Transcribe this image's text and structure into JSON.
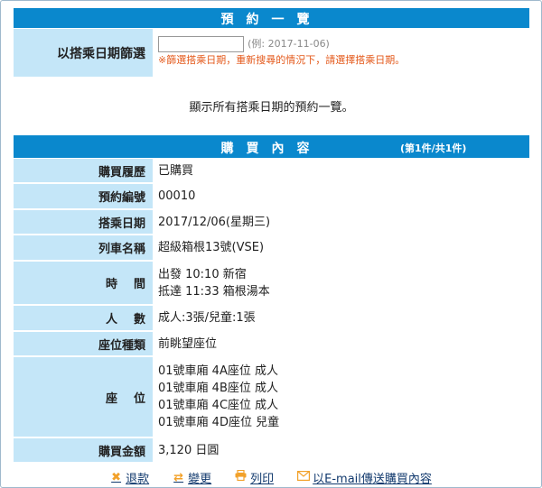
{
  "search": {
    "title": "預約一覽",
    "date_label": "以搭乘日期篩選",
    "date_value": "",
    "example": "(例: 2017-11-06)",
    "notice": "※篩選搭乘日期，重新搜尋的情況下，請選擇搭乘日期。",
    "all_message": "顯示所有搭乘日期的預約一覽。"
  },
  "detail": {
    "title": "購買內容",
    "count": "(第1件/共1件)",
    "rows": [
      {
        "label": "購買履歷",
        "lines": [
          "已購買"
        ]
      },
      {
        "label": "預約編號",
        "lines": [
          "00010"
        ]
      },
      {
        "label": "搭乘日期",
        "lines": [
          "2017/12/06(星期三)"
        ]
      },
      {
        "label": "列車名稱",
        "lines": [
          "超級箱根13號(VSE)"
        ]
      },
      {
        "label": "時間",
        "lines": [
          "出發 10:10 新宿",
          "抵達 11:33 箱根湯本"
        ]
      },
      {
        "label": "人數",
        "lines": [
          "成人:3張/兒童:1張"
        ]
      },
      {
        "label": "座位種類",
        "lines": [
          "前眺望座位"
        ]
      },
      {
        "label": "座位",
        "lines": [
          "01號車廂 4A座位 成人",
          "01號車廂 4B座位 成人",
          "01號車廂 4C座位 成人",
          "01號車廂 4D座位 兒童"
        ]
      },
      {
        "label": "購買金額",
        "lines": [
          "3,120 日圓"
        ]
      }
    ]
  },
  "actions": {
    "refund": "退款",
    "change": "變更",
    "print": "列印",
    "email": "以E-mail傳送購買內容"
  },
  "colors": {
    "header": "#0a88cd",
    "label_bg": "#c4e6f8",
    "notice": "#e45a1c",
    "link": "#123a6e",
    "icon": "#f2a12a"
  }
}
